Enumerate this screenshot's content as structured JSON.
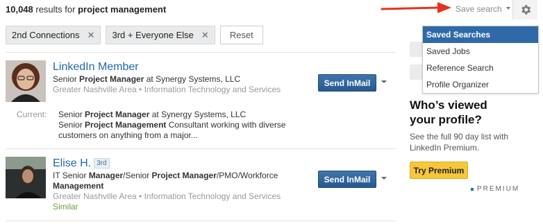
{
  "header": {
    "results_count": "10,048",
    "results_text": " results for ",
    "query": "project management",
    "save_search_label": "Save search"
  },
  "filters": {
    "chips": [
      "2nd Connections",
      "3rd + Everyone Else"
    ],
    "reset_label": "Reset"
  },
  "results": [
    {
      "name": "LinkedIn Member",
      "degree": "",
      "headline_prefix": "Senior ",
      "headline_bold": "Project Manager",
      "headline_suffix": " at Synergy Systems, LLC",
      "meta": "Greater Nashville Area • Information Technology and Services",
      "action_label": "Send InMail",
      "current_label": "Current:",
      "current_line1_prefix": "Senior ",
      "current_line1_bold": "Project Manager",
      "current_line1_suffix": " at Synergy Systems, LLC",
      "current_line2_prefix": "Senior ",
      "current_line2_bold": "Project Management",
      "current_line2_suffix": " Consultant working with diverse",
      "current_line3": "customers on anything from a major..."
    },
    {
      "name": "Elise H.",
      "degree": "3rd",
      "headline_part1": "IT Senior ",
      "headline_bold1": "Manager",
      "headline_part2": "/Senior ",
      "headline_bold2": "Project Manager",
      "headline_part3": "/PMO/Workforce",
      "headline_bold3": "Management",
      "meta": "Greater Nashville Area • Information Technology and Services",
      "similar_label": "Similar",
      "action_label": "Send InMail"
    }
  ],
  "settings_menu": {
    "items": [
      "Saved Searches",
      "Saved Jobs",
      "Reference Search",
      "Profile Organizer"
    ],
    "active_index": 0
  },
  "promo": {
    "title_line1": "Who’s viewed",
    "title_line2": "your profile?",
    "subtitle": "See the full 90 day list with LinkedIn Premium.",
    "button_label": "Try Premium",
    "premium_label": "PREMIUM"
  },
  "colors": {
    "link_blue": "#1c6aa8",
    "menu_active": "#2f69a8",
    "arrow_red": "#e8321e",
    "premium_yellow": "#f6c63d"
  }
}
